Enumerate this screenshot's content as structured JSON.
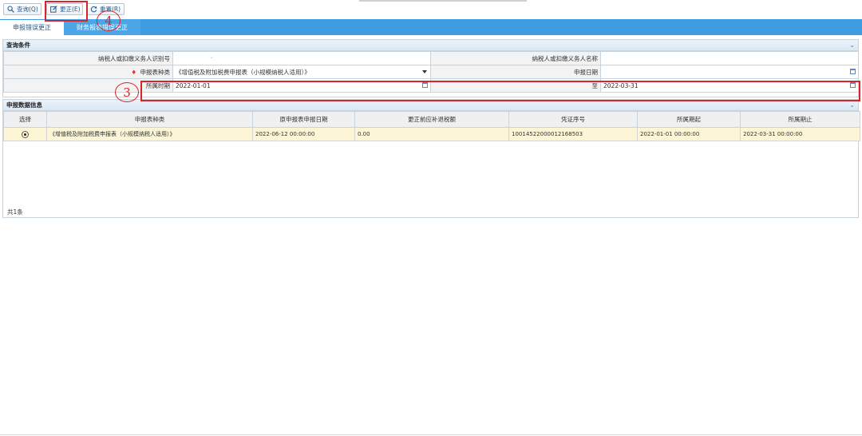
{
  "toolbar": {
    "query_label": "查询(Q)",
    "correct_label": "更正(E)",
    "reset_label": "重置(R)"
  },
  "tabs": [
    {
      "label": "申报错误更正",
      "active": true
    },
    {
      "label": "财务报表错误更正",
      "active": false
    }
  ],
  "query_panel": {
    "title": "查询条件",
    "taxpayer_id_label": "纳税人或扣缴义务人识别号",
    "taxpayer_id_value": "",
    "taxpayer_name_label": "纳税人或扣缴义务人名称",
    "taxpayer_name_value": "",
    "form_type_label": "申报表种类",
    "form_type_value": "《增值税及附加税费申报表（小规模纳税人适用）》",
    "declare_date_label": "申报日期",
    "declare_date_value": "",
    "period_label": "所属时期",
    "period_start": "2022-01-01",
    "to_label": "至",
    "period_end": "2022-03-31"
  },
  "data_panel": {
    "title": "申报数据信息",
    "columns": [
      "选择",
      "申报表种类",
      "原申报表申报日期",
      "更正前应补退税额",
      "凭证序号",
      "所属期起",
      "所属期止"
    ],
    "rows": [
      {
        "form_type": "《增值税及附加税费申报表（小规模纳税人适用）》",
        "declare_date": "2022-06-12 00:00:00",
        "amount": "0.00",
        "voucher_no": "10014522000012168503",
        "period_start": "2022-01-01 00:00:00",
        "period_end": "2022-03-31 00:00:00"
      }
    ],
    "count_text": "共1条"
  },
  "annotations": {
    "step3": "3",
    "step4": "4",
    "color": "#d8232a"
  },
  "colors": {
    "tab_bar": "#3e9de1",
    "selected_row": "#fcf6d6"
  }
}
